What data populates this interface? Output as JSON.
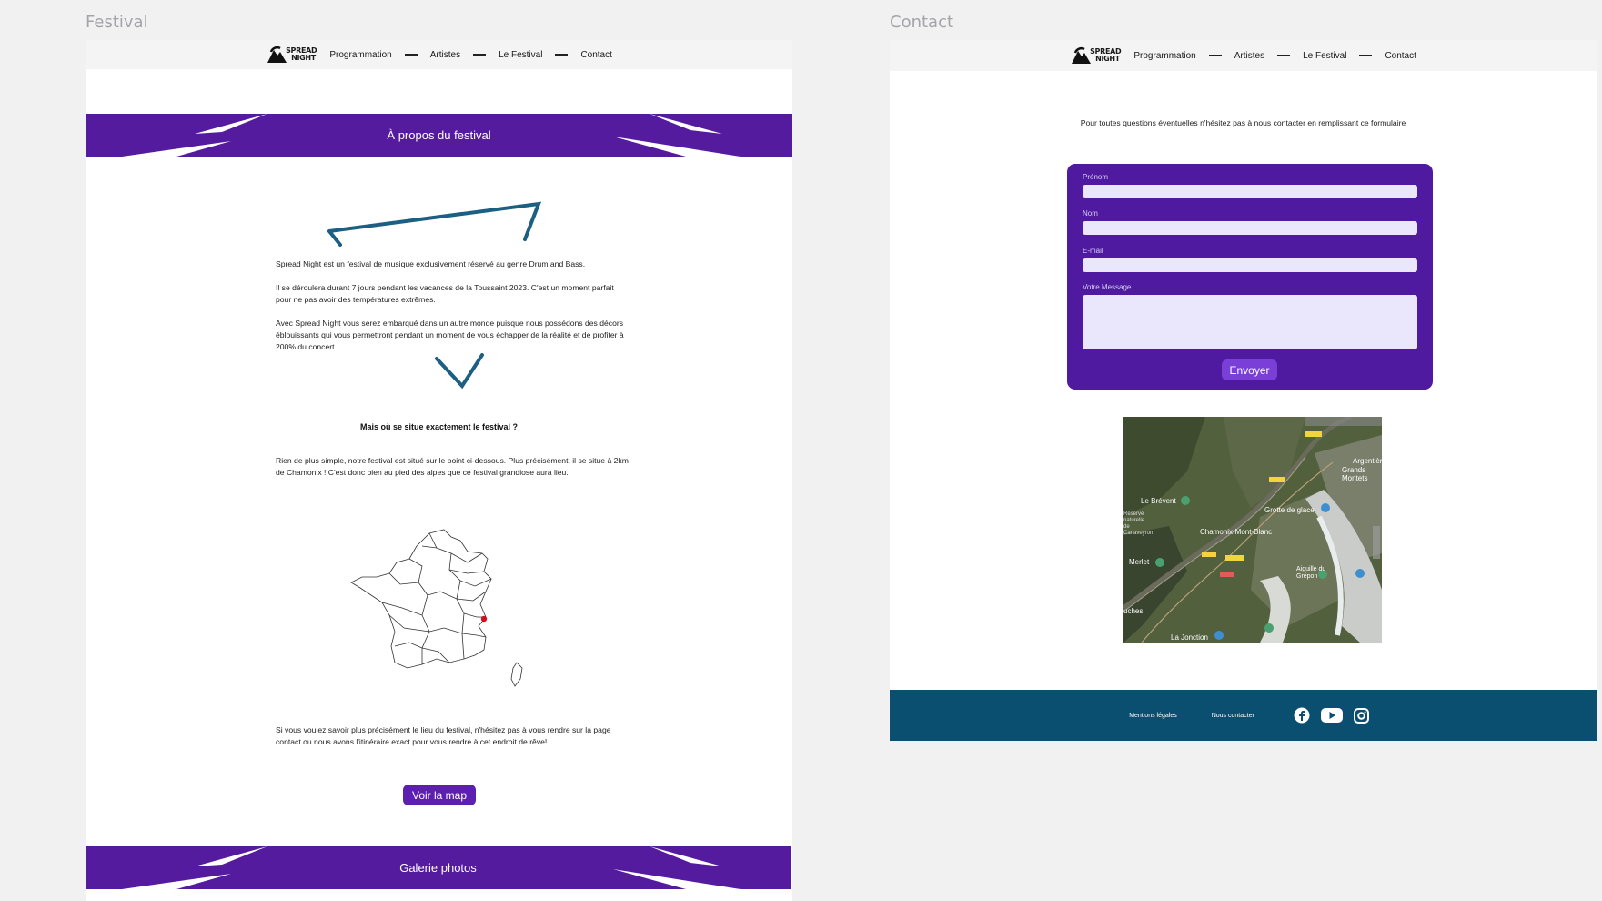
{
  "frames": {
    "festival_label": "Festival",
    "contact_label": "Contact"
  },
  "nav": {
    "logo_line1": "SPREAD",
    "logo_line2": "NIGHT",
    "items": [
      "Programmation",
      "Artistes",
      "Le Festival",
      "Contact"
    ]
  },
  "festival": {
    "about_banner": "À propos du festival",
    "p1": "Spread Night est un festival de musique exclusivement réservé au genre Drum and Bass.",
    "p2": "Il se déroulera durant 7 jours pendant les vacances de la Toussaint 2023. C'est un moment parfait pour ne pas avoir des températures extrêmes.",
    "p3": "Avec Spread Night vous serez embarqué dans un autre monde puisque nous possédons des décors éblouissants qui vous permettront pendant un moment de vous échapper de la réalité et de profiter à 200% du concert.",
    "location_heading": "Mais où se situe exactement le festival ?",
    "location_text": "Rien de plus simple, notre festival est situé sur le point ci-dessous. Plus précisément, il se situe à 2km de Chamonix ! C'est donc bien au pied des alpes que ce festival grandiose aura lieu.",
    "contact_text": "Si vous voulez savoir plus précisément le lieu du festival, n'hésitez pas à vous rendre sur la page contact ou nous avons l'itinéraire exact pour vous rendre à cet endroit de rêve!",
    "map_button": "Voir la map",
    "gallery_banner": "Galerie photos"
  },
  "contact": {
    "intro": "Pour toutes questions éventuelles n'hésitez pas à nous contacter en remplissant ce formulaire",
    "form": {
      "firstname_label": "Prénom",
      "lastname_label": "Nom",
      "email_label": "E-mail",
      "message_label": "Votre Message",
      "submit": "Envoyer"
    },
    "map_labels": {
      "brevent": "Le Brévent",
      "grotte": "Grotte de glace",
      "chamonix": "Chamonix-Mont-Blanc",
      "argentiere": "Argentière",
      "grands_montets": "Grands Montets",
      "aiguille": "Aiguille du Grépon",
      "merlet": "Merlet",
      "jonction": "La Jonction",
      "reserve": "Réserve naturelle de Carlaveyron",
      "houches": "uches"
    },
    "footer": {
      "legal": "Mentions légales",
      "contact": "Nous contacter"
    }
  },
  "colors": {
    "purple": "#541b9f",
    "dark_purple": "#4f1aa0",
    "button_purple": "#5d1fb0",
    "footer_blue": "#0b4f70",
    "accent_line": "#1c5f83",
    "map_marker": "#d01020"
  }
}
